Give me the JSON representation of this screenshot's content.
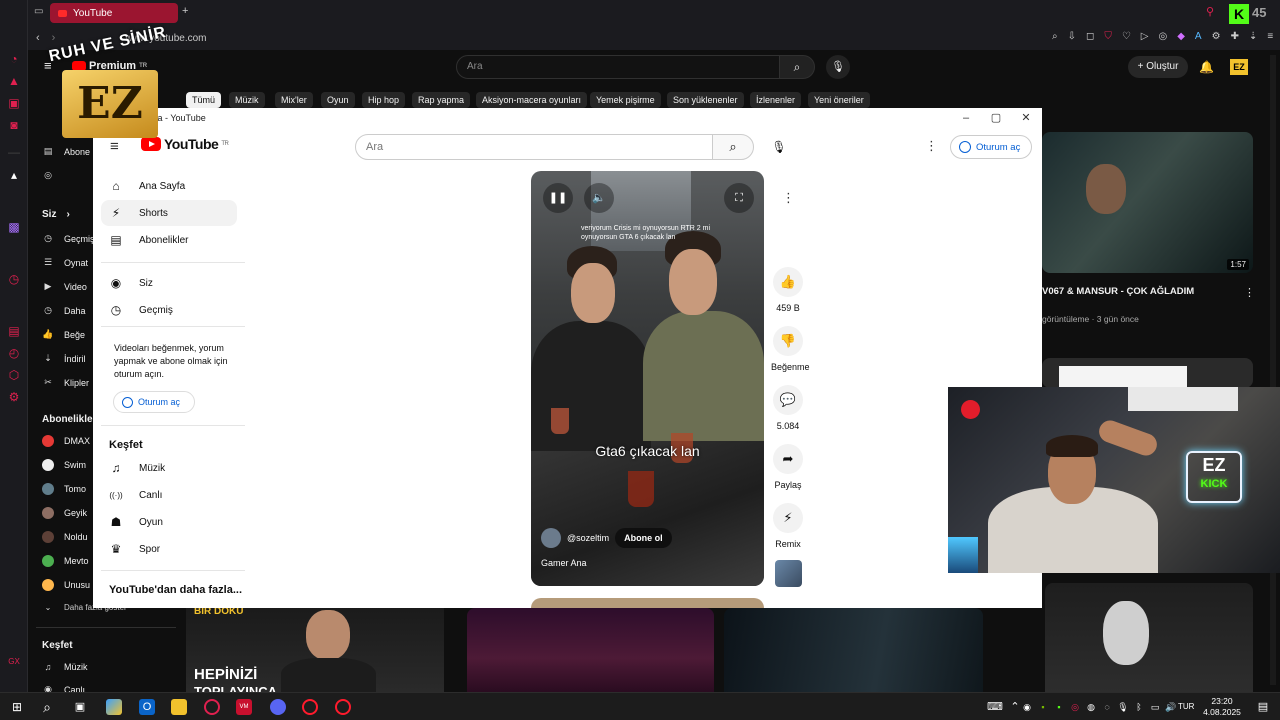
{
  "browser": {
    "tab_title": "YouTube",
    "url": "www.youtube.com",
    "accent": "#9b1530"
  },
  "overlay_logo": {
    "top_text": "RUH VE SİNİR",
    "mark": "EZ"
  },
  "background_page": {
    "search_placeholder": "Ara",
    "create_label": "Oluştur",
    "premium_label": "Premium",
    "premium_region": "TR",
    "chips": [
      "Tümü",
      "Müzik",
      "Mix'ler",
      "Oyun",
      "Hip hop",
      "Rap yapma",
      "Aksiyon-macera oyunları",
      "Yemek pişirme",
      "Son yüklenenler",
      "İzlenenler",
      "Yeni öneriler"
    ],
    "sidebar": {
      "section_you": "Siz",
      "you_items": [
        "Geçmiş",
        "Oynat",
        "Video",
        "Daha",
        "Beğe",
        "İndiril",
        "Klipler"
      ],
      "section_subs": "Abonelikler",
      "subs": [
        "DMAX",
        "Swim",
        "Tomo",
        "Geyik",
        "Noldu",
        "Mevto",
        "Unusu"
      ],
      "show_more": "Daha fazla göster",
      "section_explore": "Keşfet",
      "explore_items": [
        "Müzik",
        "Canlı"
      ],
      "partial_items": [
        "Abone"
      ]
    },
    "right_video": {
      "title": "V067 & MANSUR - ÇOK AĞLADIM",
      "meta": "görüntüleme · 3 gün önce",
      "duration": "1:57"
    },
    "bottom_thumb_text": {
      "line1": "BİR DOKU",
      "line2": "HEPİNİZİ",
      "line3": "TOPLAYINCA"
    }
  },
  "popup": {
    "window_title": "Gamer Ana - YouTube",
    "logo_text": "YouTube",
    "logo_region": "TR",
    "search_placeholder": "Ara",
    "signin_label": "Oturum aç",
    "nav": [
      {
        "label": "Ana Sayfa",
        "icon": "home-icon"
      },
      {
        "label": "Shorts",
        "icon": "shorts-icon"
      },
      {
        "label": "Abonelikler",
        "icon": "subscriptions-icon"
      }
    ],
    "nav2": [
      {
        "label": "Siz",
        "icon": "user-circle-icon"
      },
      {
        "label": "Geçmiş",
        "icon": "history-icon"
      }
    ],
    "signin_note": "Videoları beğenmek, yorum yapmak ve abone olmak için oturum açın.",
    "explore_title": "Keşfet",
    "explore": [
      {
        "label": "Müzik",
        "icon": "music-icon"
      },
      {
        "label": "Canlı",
        "icon": "live-icon"
      },
      {
        "label": "Oyun",
        "icon": "gamepad-icon"
      },
      {
        "label": "Spor",
        "icon": "trophy-icon"
      }
    ],
    "more_from_yt": "YouTube'dan daha fazla..."
  },
  "short": {
    "caption": "veriyorum Crisis mi oynuyorsun RTR 2 mi oynuyorsun GTA 6 çıkacak lan",
    "overlay_text": "Gta6 çıkacak lan",
    "channel": "@sozeltim",
    "subscribe": "Abone ol",
    "title": "Gamer Ana",
    "actions": {
      "likes": "459 B",
      "dislike": "Beğenme",
      "comments": "5.084",
      "share": "Paylaş",
      "remix": "Remix"
    }
  },
  "webcam": {
    "neon_line1": "EZ",
    "neon_line2": "KICK"
  },
  "taskbar": {
    "time": "23:20",
    "date": "4.08.2025",
    "lang": "TUR"
  }
}
